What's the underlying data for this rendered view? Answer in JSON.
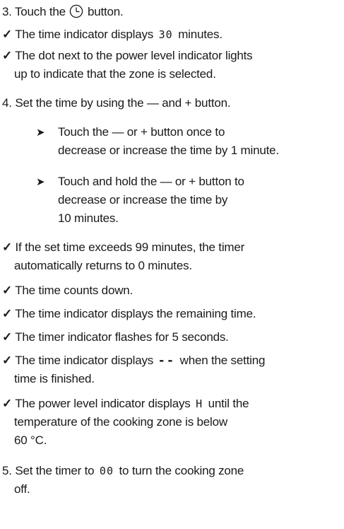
{
  "steps": {
    "s3": {
      "num": "3.",
      "pre": "Touch the",
      "post": "button."
    },
    "s4": {
      "num": "4.",
      "text": "Set the time by using the — and + button."
    },
    "s5": {
      "num": "5.",
      "pre": "Set the timer to",
      "display": "00",
      "post_a": "to turn the cooking zone",
      "post_b": "off."
    }
  },
  "results": {
    "r1": {
      "check": "✓",
      "pre": "The time indicator displays",
      "display": "30",
      "post": "minutes."
    },
    "r2": {
      "check": "✓",
      "line1": "The dot next to the power level indicator lights",
      "line2": "up to indicate that the zone is selected."
    },
    "r3": {
      "check": "✓",
      "line1": "If the set time exceeds 99 minutes, the timer",
      "line2": "automatically returns to 0 minutes."
    },
    "r4": {
      "check": "✓",
      "text": "The time counts down."
    },
    "r5": {
      "check": "✓",
      "text": "The time indicator displays the remaining time."
    },
    "r6": {
      "check": "✓",
      "text": "The timer indicator flashes for 5 seconds."
    },
    "r7": {
      "check": "✓",
      "pre": "The time indicator displays",
      "display": "--",
      "post": "when the setting",
      "line2": "time is finished."
    },
    "r8": {
      "check": "✓",
      "pre": "The power level indicator displays",
      "display": "H",
      "post": "until the",
      "line2": "temperature of the cooking zone is below",
      "line3": "60 °C."
    }
  },
  "substeps": {
    "a": {
      "arrow": "➤",
      "line1": "Touch the — or + button once to",
      "line2": "decrease or increase the time by 1 minute."
    },
    "b": {
      "arrow": "➤",
      "line1": "Touch and hold the — or + button to",
      "line2": "decrease or increase the time by",
      "line3": "10 minutes."
    }
  },
  "icons": {
    "timer": "timer-clock-icon"
  }
}
